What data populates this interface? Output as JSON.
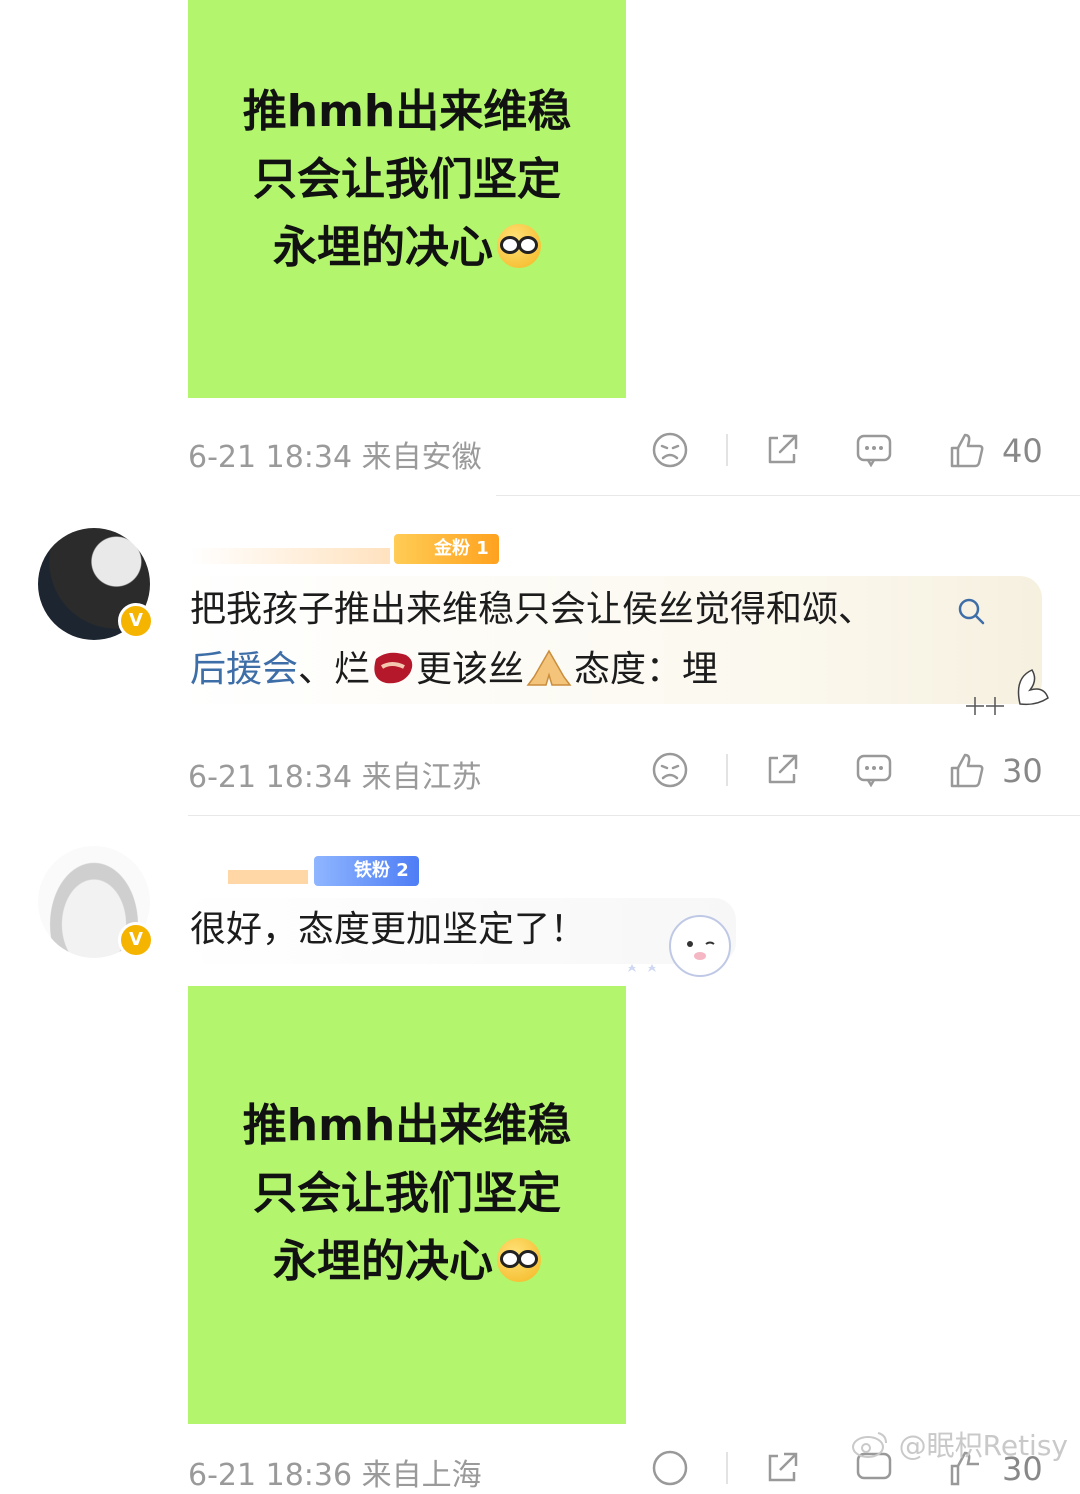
{
  "posts": [
    {
      "image_lines": [
        "推hmh出来维稳",
        "只会让我们坚定",
        "永埋的决心"
      ],
      "image_emoji": "nerd-face-emoji",
      "meta": {
        "time": "6-21 18:34 来自安徽",
        "likes": "40"
      }
    },
    {
      "comment_prefix": "把我孩子推出来维稳只会让侯丝觉得和颂、",
      "comment_link": "后援会",
      "comment_mid": "、烂",
      "comment_mid2": "更该丝",
      "comment_suffix": "态度：埋",
      "emoji_1": "steak-emoji",
      "emoji_2": "pray-emoji",
      "badge": "金粉 1",
      "meta": {
        "time": "6-21 18:34 来自江苏",
        "likes": "30"
      }
    },
    {
      "comment": "很好，态度更加坚定了！",
      "badge": "铁粉 2",
      "image_lines": [
        "推hmh出来维稳",
        "只会让我们坚定",
        "永埋的决心"
      ],
      "image_emoji": "nerd-face-emoji",
      "meta": {
        "time": "6-21 18:36 来自上海",
        "likes": "30"
      }
    }
  ],
  "credit": "@眠枳Retisy"
}
